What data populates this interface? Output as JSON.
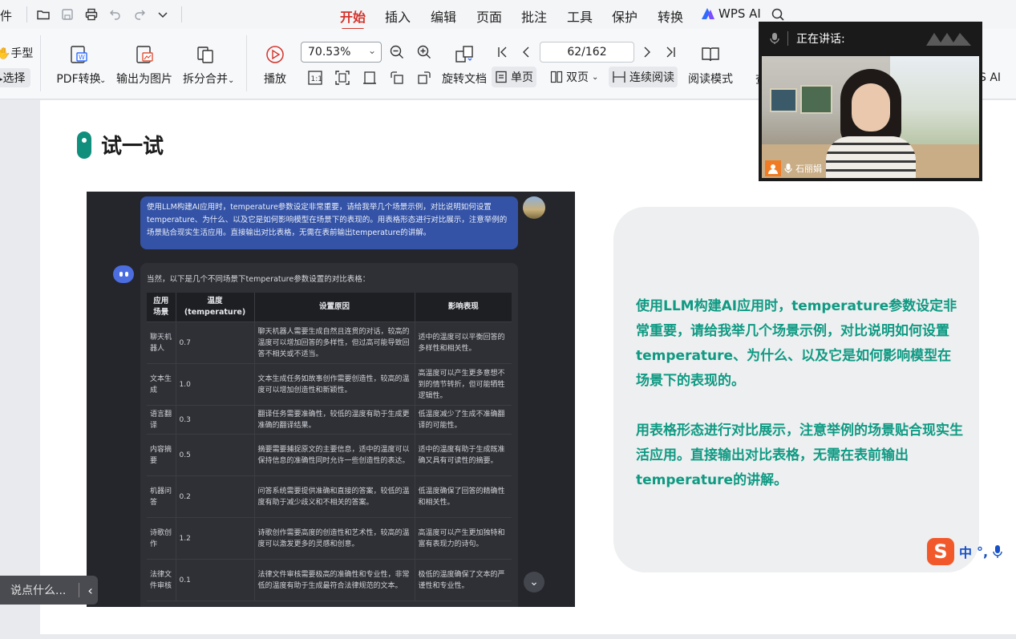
{
  "menubar": {
    "file_label": "文件",
    "tabs": [
      "开始",
      "插入",
      "编辑",
      "页面",
      "批注",
      "工具",
      "保护",
      "转换"
    ],
    "active_tab": "开始",
    "wps_ai": "WPS AI",
    "accent": "#d4342c"
  },
  "ribbon": {
    "hand_label": "手型",
    "select_label": "选择",
    "pdf_convert": "PDF转换",
    "export_image": "输出为图片",
    "split_merge": "拆分合并",
    "play": "播放",
    "zoom": "70.53%",
    "rotate": "旋转文档",
    "page_indicator": "62/162",
    "single_page": "单页",
    "double_page": "双页",
    "continuous": "连续阅读",
    "reading_mode": "阅读模式",
    "partial_left": "查",
    "partial_ai": "S AI"
  },
  "doc": {
    "section_title": "试一试",
    "chat": {
      "user_message": "使用LLM构建AI应用时，temperature参数设定非常重要，请给我举几个场景示例，对比说明如何设置temperature、为什么、以及它是如何影响模型在场景下的表现的。用表格形态进行对比展示，注意举例的场景贴合现实生活应用。直接输出对比表格，无需在表前输出temperature的讲解。",
      "bot_intro": "当然，以下是几个不同场景下temperature参数设置的对比表格：",
      "table_headers": [
        "应用场景",
        "温度 (temperature)",
        "设置原因",
        "影响表现"
      ],
      "table_rows": [
        {
          "scene": "聊天机器人",
          "temp": "0.7",
          "reason": "聊天机器人需要生成自然且连贯的对话，较高的温度可以增加回答的多样性，但过高可能导致回答不相关或不适当。",
          "effect": "适中的温度可以平衡回答的多样性和相关性。"
        },
        {
          "scene": "文本生成",
          "temp": "1.0",
          "reason": "文本生成任务如故事创作需要创造性，较高的温度可以增加创造性和新颖性。",
          "effect": "高温度可以产生更多意想不到的情节转折，但可能牺牲逻辑性。"
        },
        {
          "scene": "语言翻译",
          "temp": "0.3",
          "reason": "翻译任务需要准确性，较低的温度有助于生成更准确的翻译结果。",
          "effect": "低温度减少了生成不准确翻译的可能性。"
        },
        {
          "scene": "内容摘要",
          "temp": "0.5",
          "reason": "摘要需要捕捉原文的主要信息，适中的温度可以保持信息的准确性同时允许一些创造性的表达。",
          "effect": "适中的温度有助于生成既准确又具有可读性的摘要。"
        },
        {
          "scene": "机器问答",
          "temp": "0.2",
          "reason": "问答系统需要提供准确和直接的答案，较低的温度有助于减少歧义和不相关的答案。",
          "effect": "低温度确保了回答的精确性和相关性。"
        },
        {
          "scene": "诗歌创作",
          "temp": "1.2",
          "reason": "诗歌创作需要高度的创造性和艺术性，较高的温度可以激发更多的灵感和创意。",
          "effect": "高温度可以产生更加独特和富有表现力的诗句。"
        },
        {
          "scene": "法律文件审核",
          "temp": "0.1",
          "reason": "法律文件审核需要极高的准确性和专业性，非常低的温度有助于生成最符合法律规范的文本。",
          "effect": "极低的温度确保了文本的严谨性和专业性。"
        }
      ]
    },
    "prompt_para1": "使用LLM构建AI应用时，temperature参数设定非常重要，请给我举几个场景示例，对比说明如何设置temperature、为什么、以及它是如何影响模型在场景下的表现的。",
    "prompt_para2": "用表格形态进行对比展示，注意举例的场景贴合现实生活应用。直接输出对比表格，无需在表前输出temperature的讲解。",
    "accent": "#0f9a83"
  },
  "video": {
    "speaking_label": "正在讲话:",
    "speaker_name": "石丽娟"
  },
  "comment": {
    "placeholder": "说点什么..."
  },
  "ime": {
    "lang": "中",
    "punct": "°,"
  }
}
